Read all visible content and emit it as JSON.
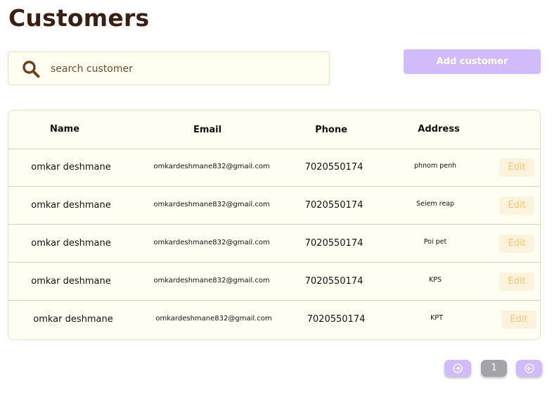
{
  "page": {
    "title": "Customers"
  },
  "search": {
    "placeholder": "search customer",
    "icon": "search-icon"
  },
  "toolbar": {
    "add_label": "Add customer"
  },
  "table": {
    "columns": [
      "Name",
      "Email",
      "Phone",
      "Address"
    ],
    "rows": [
      {
        "name": "omkar deshmane",
        "email": "omkardeshmane832@gmail.com",
        "phone": "7020550174",
        "address": "phnom penh",
        "action": "Edit"
      },
      {
        "name": "omkar deshmane",
        "email": "omkardeshmane832@gmail.com",
        "phone": "7020550174",
        "address": "Seiem reap",
        "action": "Edit"
      },
      {
        "name": "omkar deshmane",
        "email": "omkardeshmane832@gmail.com",
        "phone": "7020550174",
        "address": "Poi pet",
        "action": "Edit"
      },
      {
        "name": "omkar deshmane",
        "email": "omkardeshmane832@gmail.com",
        "phone": "7020550174",
        "address": "KPS",
        "action": "Edit"
      },
      {
        "name": "omkar deshmane",
        "email": "omkardeshmane832@gmail.com",
        "phone": "7020550174",
        "address": "KPT",
        "action": "Edit"
      }
    ]
  },
  "pagination": {
    "current_page": "1",
    "next_icon": "arrow-right-circle-icon",
    "prev_icon": "arrow-left-circle-icon"
  },
  "colors": {
    "title": "#3a1f12",
    "accent": "#d2bbfa",
    "surface": "#fffef2",
    "edit_text": "#f5c77a",
    "edit_bg": "#fdf3dc",
    "page_indicator": "#a3a3a8"
  }
}
